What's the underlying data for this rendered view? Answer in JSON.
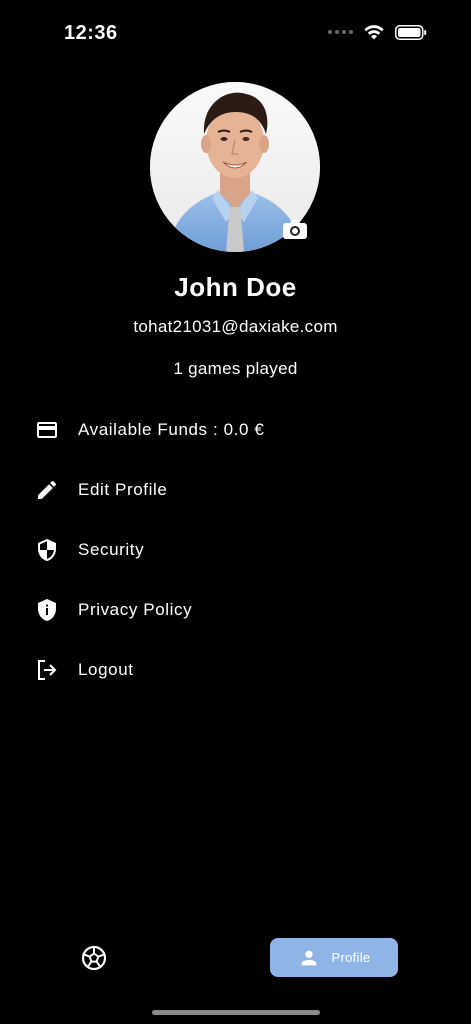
{
  "status_bar": {
    "time": "12:36"
  },
  "profile": {
    "name": "John Doe",
    "email": "tohat21031@daxiake.com",
    "games_played": "1 games played"
  },
  "menu": {
    "items": [
      {
        "label": "Available Funds : 0.0 €",
        "icon": "credit-card-icon"
      },
      {
        "label": "Edit Profile",
        "icon": "pencil-icon"
      },
      {
        "label": "Security",
        "icon": "shield-icon"
      },
      {
        "label": "Privacy Policy",
        "icon": "shield-info-icon"
      },
      {
        "label": "Logout",
        "icon": "logout-icon"
      }
    ]
  },
  "bottom_nav": {
    "items": [
      {
        "label": "",
        "icon": "soccer-ball-icon",
        "active": false
      },
      {
        "label": "Profile",
        "icon": "person-icon",
        "active": true
      }
    ]
  },
  "colors": {
    "background": "#000000",
    "accent": "#8fb4e6",
    "text": "#ffffff"
  }
}
